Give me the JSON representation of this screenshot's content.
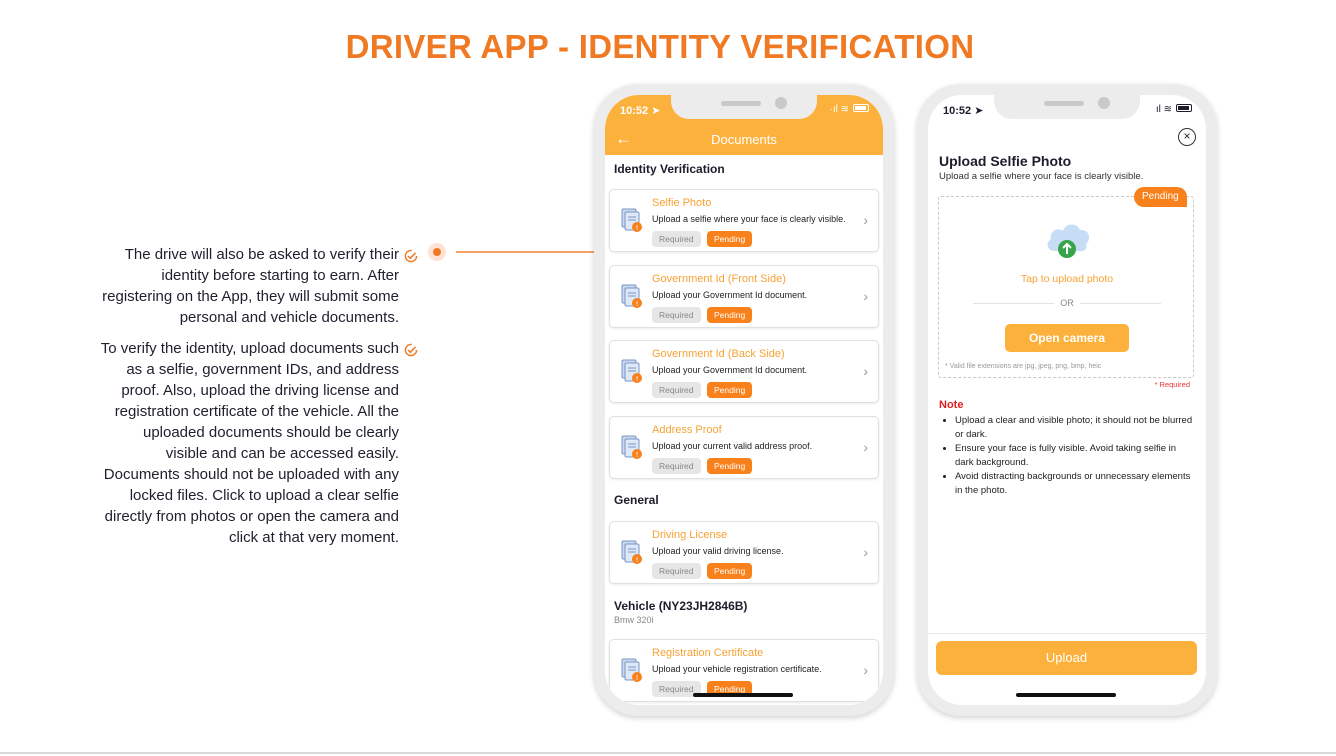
{
  "page": {
    "title": "DRIVER APP - IDENTITY VERIFICATION",
    "paragraphs": [
      "The drive will also be asked to verify their identity before starting to earn. After registering on the App, they will submit some personal and vehicle documents.",
      "To verify the identity, upload documents such as a selfie, government IDs, and address proof. Also, upload the driving license and registration certificate of the vehicle. All the uploaded documents should be clearly visible and can be accessed easily. Documents should not be uploaded with any locked files. Click to upload a clear selfie directly from photos or open the camera and click at that very moment."
    ]
  },
  "colors": {
    "brand_orange": "#f07a24",
    "app_orange": "#fdb13d",
    "pending_orange": "#f8811c"
  },
  "phone_left": {
    "status_time": "10:52",
    "app_title": "Documents",
    "back_icon": "arrow-left-icon",
    "sections": {
      "identity": "Identity Verification",
      "general": "General",
      "vehicle": "Vehicle (NY23JH2846B)",
      "vehicle_sub": "Bmw 320i"
    },
    "docs": [
      {
        "name": "Selfie Photo",
        "desc": "Upload a selfie where your face is clearly visible.",
        "required": "Required",
        "status": "Pending"
      },
      {
        "name": "Government Id (Front Side)",
        "desc": "Upload your Government Id document.",
        "required": "Required",
        "status": "Pending"
      },
      {
        "name": "Government Id (Back Side)",
        "desc": "Upload your Government Id document.",
        "required": "Required",
        "status": "Pending"
      },
      {
        "name": "Address Proof",
        "desc": "Upload your current valid address proof.",
        "required": "Required",
        "status": "Pending"
      },
      {
        "name": "Driving License",
        "desc": "Upload your valid driving license.",
        "required": "Required",
        "status": "Pending"
      },
      {
        "name": "Registration Certificate",
        "desc": "Upload your vehicle registration certificate.",
        "required": "Required",
        "status": "Pending"
      }
    ]
  },
  "phone_right": {
    "status_time": "10:52",
    "title": "Upload Selfie Photo",
    "subtitle": "Upload a selfie where your face is clearly visible.",
    "status_tag": "Pending",
    "tap_text": "Tap to upload photo",
    "or_text": "OR",
    "camera_button": "Open camera",
    "valid_ext": "* Valid file extensions are jpg, jpeg, png, bmp, heic",
    "required_note": "* Required",
    "note_heading": "Note",
    "notes": [
      "Upload a clear and visible photo; it should not be blurred or dark.",
      "Ensure your face is fully visible. Avoid taking selfie in dark background.",
      "Avoid distracting backgrounds or unnecessary elements in the photo."
    ],
    "upload_button": "Upload"
  }
}
